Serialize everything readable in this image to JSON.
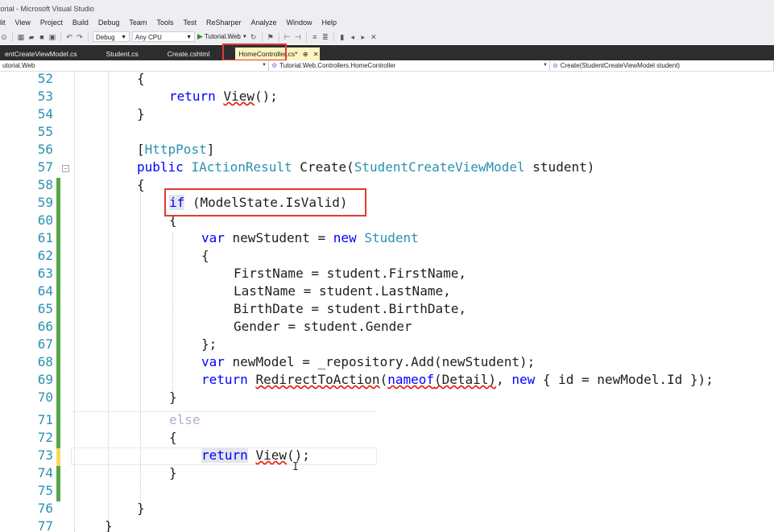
{
  "window": {
    "title": "torial - Microsoft Visual Studio"
  },
  "menu": [
    "lit",
    "View",
    "Project",
    "Build",
    "Debug",
    "Team",
    "Tools",
    "Test",
    "ReSharper",
    "Analyze",
    "Window",
    "Help"
  ],
  "toolbar": {
    "config": "Debug",
    "platform": "Any CPU",
    "start_label": "Tutorial.Web"
  },
  "tabs": [
    {
      "label": "entCreateViewModel.cs",
      "active": false
    },
    {
      "label": "Student.cs",
      "active": false
    },
    {
      "label": "Create.cshtml",
      "active": false
    },
    {
      "label": "HomeController.cs*",
      "active": true
    }
  ],
  "navbar": {
    "project": "utorial.Web",
    "class": "Tutorial.Web.Controllers.HomeController",
    "member": "Create(StudentCreateViewModel student)"
  },
  "colors": {
    "accent_red": "#e53935",
    "keyword": "#0000ff",
    "type": "#2b91af",
    "change_saved": "#57a64a",
    "change_unsaved": "#f5d95a"
  },
  "code_lines": [
    {
      "n": "52",
      "t": "{"
    },
    {
      "n": "53",
      "t": "return View();"
    },
    {
      "n": "54",
      "t": "}"
    },
    {
      "n": "55",
      "t": ""
    },
    {
      "n": "56",
      "t": "[HttpPost]"
    },
    {
      "n": "57",
      "t": "public IActionResult Create(StudentCreateViewModel student)"
    },
    {
      "n": "58",
      "t": "{"
    },
    {
      "n": "59",
      "t": "if (ModelState.IsValid)"
    },
    {
      "n": "60",
      "t": "{"
    },
    {
      "n": "61",
      "t": "var newStudent = new Student"
    },
    {
      "n": "62",
      "t": "{"
    },
    {
      "n": "63",
      "t": "FirstName = student.FirstName,"
    },
    {
      "n": "64",
      "t": "LastName = student.LastName,"
    },
    {
      "n": "65",
      "t": "BirthDate = student.BirthDate,"
    },
    {
      "n": "66",
      "t": "Gender = student.Gender"
    },
    {
      "n": "67",
      "t": "};"
    },
    {
      "n": "68",
      "t": "var newModel = _repository.Add(newStudent);"
    },
    {
      "n": "69",
      "t": "return RedirectToAction(nameof(Detail), new { id = newModel.Id });"
    },
    {
      "n": "70",
      "t": "}"
    },
    {
      "n": "71",
      "t": "else"
    },
    {
      "n": "72",
      "t": "{"
    },
    {
      "n": "73",
      "t": "return View();"
    },
    {
      "n": "74",
      "t": "}"
    },
    {
      "n": "75",
      "t": ""
    },
    {
      "n": "76",
      "t": "}"
    },
    {
      "n": "77",
      "t": "}"
    }
  ]
}
